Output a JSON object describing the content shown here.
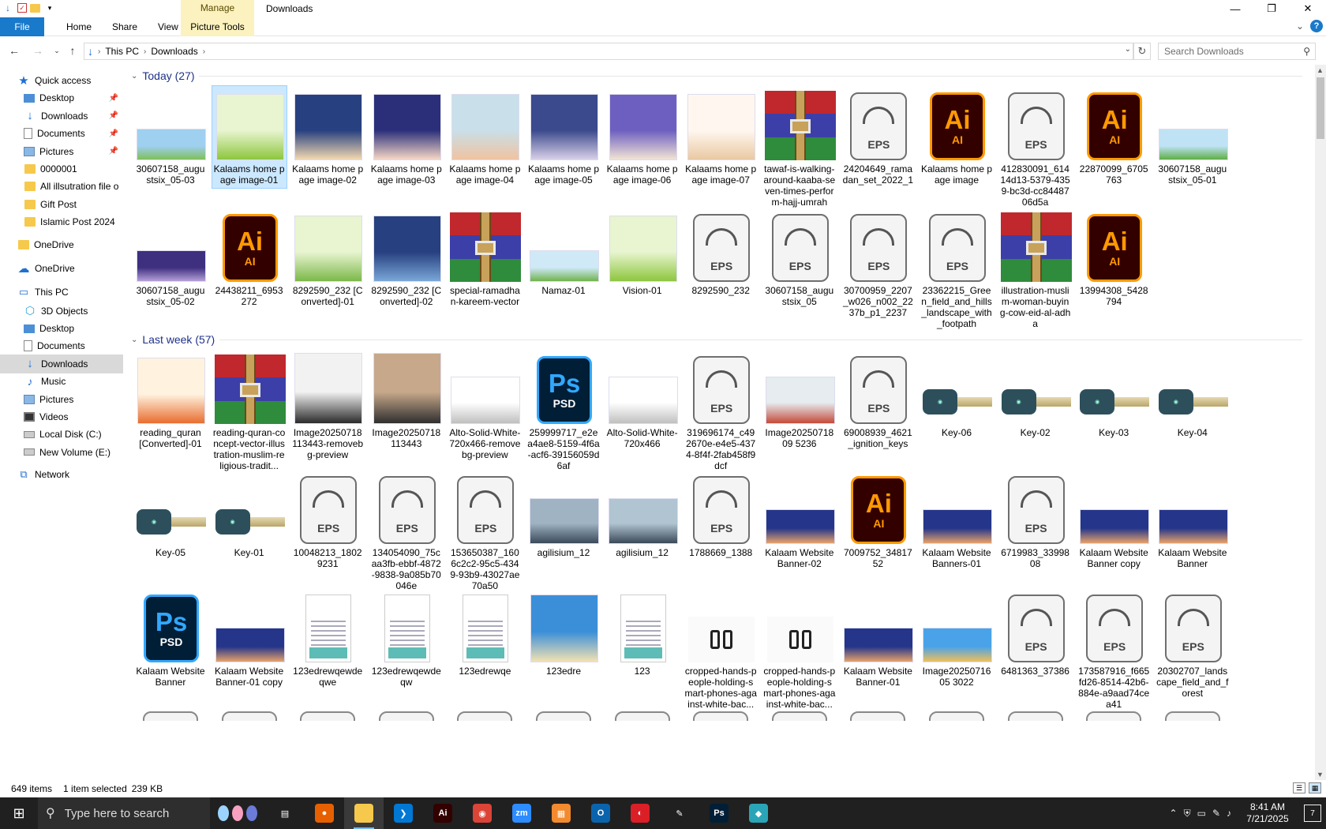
{
  "window": {
    "title": "Downloads",
    "manage_tab": "Manage",
    "picture_tools_tab": "Picture Tools",
    "ribbon_tabs": [
      "File",
      "Home",
      "Share",
      "View"
    ],
    "buttons": {
      "minimize": "—",
      "maximize": "❐",
      "close": "✕",
      "collapse": "⌄",
      "help": "?"
    }
  },
  "address": {
    "crumbs": [
      "This PC",
      "Downloads"
    ],
    "search_placeholder": "Search Downloads"
  },
  "nav": {
    "items": [
      {
        "label": "Quick access",
        "icon": "star-icon",
        "indent": 1,
        "kind": "star"
      },
      {
        "label": "Desktop",
        "icon": "desktop-icon",
        "indent": 2,
        "kind": "blue",
        "pin": true
      },
      {
        "label": "Downloads",
        "icon": "download-icon",
        "indent": 2,
        "kind": "dl",
        "pin": true
      },
      {
        "label": "Documents",
        "icon": "documents-icon",
        "indent": 2,
        "kind": "doc",
        "pin": true
      },
      {
        "label": "Pictures",
        "icon": "pictures-icon",
        "indent": 2,
        "kind": "pic",
        "pin": true
      },
      {
        "label": "0000001",
        "icon": "folder-icon",
        "indent": 2,
        "kind": "folder"
      },
      {
        "label": "All illsutration file o",
        "icon": "folder-icon",
        "indent": 2,
        "kind": "folder"
      },
      {
        "label": "Gift Post",
        "icon": "folder-icon",
        "indent": 2,
        "kind": "folder"
      },
      {
        "label": "Islamic Post 2024",
        "icon": "folder-icon",
        "indent": 2,
        "kind": "folder"
      },
      {
        "label": "OneDrive",
        "icon": "folder-icon",
        "indent": 1,
        "kind": "folder",
        "gap": 6
      },
      {
        "label": "OneDrive",
        "icon": "cloud-icon",
        "indent": 1,
        "kind": "cloud",
        "gap": 6
      },
      {
        "label": "This PC",
        "icon": "computer-icon",
        "indent": 1,
        "kind": "pc",
        "gap": 6
      },
      {
        "label": "3D Objects",
        "icon": "3d-objects-icon",
        "indent": 2,
        "kind": "3d"
      },
      {
        "label": "Desktop",
        "icon": "desktop-icon",
        "indent": 2,
        "kind": "blue"
      },
      {
        "label": "Documents",
        "icon": "documents-icon",
        "indent": 2,
        "kind": "doc"
      },
      {
        "label": "Downloads",
        "icon": "download-icon",
        "indent": 2,
        "kind": "dl",
        "selected": true
      },
      {
        "label": "Music",
        "icon": "music-icon",
        "indent": 2,
        "kind": "music"
      },
      {
        "label": "Pictures",
        "icon": "pictures-icon",
        "indent": 2,
        "kind": "pic"
      },
      {
        "label": "Videos",
        "icon": "videos-icon",
        "indent": 2,
        "kind": "vid"
      },
      {
        "label": "Local Disk (C:)",
        "icon": "disk-icon",
        "indent": 2,
        "kind": "disk"
      },
      {
        "label": "New Volume (E:)",
        "icon": "disk-icon",
        "indent": 2,
        "kind": "disk"
      },
      {
        "label": "Network",
        "icon": "network-icon",
        "indent": 1,
        "kind": "net",
        "gap": 6
      }
    ]
  },
  "groups": [
    {
      "header": "Today (27)",
      "rows": [
        [
          {
            "label": "30607158_augustsix_05-03",
            "type": "img",
            "colors": [
              "#9fd0f0",
              "#7fbf5a"
            ],
            "h": 40
          },
          {
            "label": "Kalaams home page image-01",
            "type": "img",
            "colors": [
              "#e8f5d0",
              "#8dc63f"
            ],
            "h": 84,
            "selected": true
          },
          {
            "label": "Kalaams home page image-02",
            "type": "img",
            "colors": [
              "#27407f",
              "#f3d9b1"
            ],
            "h": 84
          },
          {
            "label": "Kalaams home page image-03",
            "type": "img",
            "colors": [
              "#2b2f7a",
              "#f5d7c7"
            ],
            "h": 84
          },
          {
            "label": "Kalaams home page image-04",
            "type": "img",
            "colors": [
              "#c9dfe9",
              "#f0c3a0"
            ],
            "h": 84
          },
          {
            "label": "Kalaams home page image-05",
            "type": "img",
            "colors": [
              "#3b4a8c",
              "#d8d0e8"
            ],
            "h": 84
          },
          {
            "label": "Kalaams home page image-06",
            "type": "img",
            "colors": [
              "#6d5fc0",
              "#f2e4d5"
            ],
            "h": 84
          },
          {
            "label": "Kalaams home page image-07",
            "type": "img",
            "colors": [
              "#fff7ef",
              "#e9c9a2"
            ],
            "h": 84
          },
          {
            "label": "tawaf-is-walking-around-kaaba-seven-times-perform-hajj-umrah",
            "type": "rar"
          },
          {
            "label": "24204649_ramadan_set_2022_1",
            "type": "eps"
          },
          {
            "label": "Kalaams home page image",
            "type": "ai"
          },
          {
            "label": "412830091_61414d13-5379-4359-bc3d-cc8448706d5a",
            "type": "eps"
          },
          {
            "label": "22870099_6705763",
            "type": "ai"
          },
          {
            "label": "30607158_augustsix_05-01",
            "type": "img",
            "colors": [
              "#bfe3f5",
              "#5fae46"
            ],
            "h": 40
          }
        ],
        [
          {
            "label": "30607158_augustsix_05-02",
            "type": "img",
            "colors": [
              "#3e2f7f",
              "#b6a0d8"
            ],
            "h": 40
          },
          {
            "label": "24438211_6953272",
            "type": "ai"
          },
          {
            "label": "8292590_232 [Converted]-01",
            "type": "img",
            "colors": [
              "#e8f5d0",
              "#7cb84a"
            ],
            "h": 84
          },
          {
            "label": "8292590_232 [Converted]-02",
            "type": "img",
            "colors": [
              "#27407f",
              "#7aa7d9"
            ],
            "h": 84
          },
          {
            "label": "special-ramadhan-kareem-vector",
            "type": "rar"
          },
          {
            "label": "Namaz-01",
            "type": "img",
            "colors": [
              "#cfe9f7",
              "#6fb34c"
            ],
            "h": 40
          },
          {
            "label": "Vision-01",
            "type": "img",
            "colors": [
              "#e8f5d0",
              "#8dc63f"
            ],
            "h": 84
          },
          {
            "label": "8292590_232",
            "type": "eps"
          },
          {
            "label": "30607158_augustsix_05",
            "type": "eps"
          },
          {
            "label": "30700959_2207_w026_n002_2237b_p1_2237",
            "type": "eps"
          },
          {
            "label": "23362215_Green_field_and_hills_landscape_with_footpath",
            "type": "eps"
          },
          {
            "label": "illustration-muslim-woman-buying-cow-eid-al-adha",
            "type": "rar"
          },
          {
            "label": "13994308_5428794",
            "type": "ai"
          }
        ]
      ]
    },
    {
      "header": "Last week (57)",
      "rows": [
        [
          {
            "label": "reading_quran [Converted]-01",
            "type": "img",
            "colors": [
              "#fff3e0",
              "#e86d2f"
            ],
            "h": 84
          },
          {
            "label": "reading-quran-concept-vector-illustration-muslim-religious-tradit...",
            "type": "rar"
          },
          {
            "label": "Image20250718113443-removebg-preview",
            "type": "img",
            "colors": [
              "#f2f2f2",
              "#2b2b2b"
            ],
            "h": 90
          },
          {
            "label": "Image20250718113443",
            "type": "img",
            "colors": [
              "#c7a88a",
              "#2f2f2f"
            ],
            "h": 90
          },
          {
            "label": "Alto-Solid-White-720x466-removebg-preview",
            "type": "img",
            "colors": [
              "#ffffff",
              "#bfbfbf"
            ],
            "h": 60
          },
          {
            "label": "259999717_e2ea4ae8-5159-4f6a-acf6-39156059d6af",
            "type": "ps"
          },
          {
            "label": "Alto-Solid-White-720x466",
            "type": "img",
            "colors": [
              "#ffffff",
              "#c0c0c0"
            ],
            "h": 60
          },
          {
            "label": "319696174_c492670e-e4e5-4374-8f4f-2fab458f9dcf",
            "type": "eps"
          },
          {
            "label": "Image2025071809 5236",
            "type": "img",
            "colors": [
              "#e6ecef",
              "#c44a3a"
            ],
            "h": 60
          },
          {
            "label": "69008939_4621_ignition_keys",
            "type": "eps"
          },
          {
            "label": "Key-06",
            "type": "key"
          },
          {
            "label": "Key-02",
            "type": "key"
          },
          {
            "label": "Key-03",
            "type": "key"
          },
          {
            "label": "Key-04",
            "type": "key"
          }
        ],
        [
          {
            "label": "Key-05",
            "type": "key"
          },
          {
            "label": "Key-01",
            "type": "key"
          },
          {
            "label": "10048213_18029231",
            "type": "eps"
          },
          {
            "label": "134054090_75caa3fb-ebbf-4872-9838-9a085b70046e",
            "type": "eps"
          },
          {
            "label": "153650387_1606c2c2-95c5-4349-93b9-43027ae70a50",
            "type": "eps"
          },
          {
            "label": "agilisium_12",
            "type": "img",
            "colors": [
              "#9fb3c2",
              "#3a4a5a"
            ],
            "h": 58
          },
          {
            "label": "agilisium_12",
            "type": "img",
            "colors": [
              "#b0c4d2",
              "#3c4a58"
            ],
            "h": 58
          },
          {
            "label": "1788669_1388",
            "type": "eps"
          },
          {
            "label": "Kalaam Website Banner-02",
            "type": "img",
            "colors": [
              "#25358a",
              "#e8a36a"
            ],
            "h": 44
          },
          {
            "label": "7009752_3481752",
            "type": "ai"
          },
          {
            "label": "Kalaam Website Banners-01",
            "type": "img",
            "colors": [
              "#25358a",
              "#e8a36a"
            ],
            "h": 44
          },
          {
            "label": "6719983_3399808",
            "type": "eps"
          },
          {
            "label": "Kalaam Website Banner copy",
            "type": "img",
            "colors": [
              "#25358a",
              "#e8a36a"
            ],
            "h": 44
          },
          {
            "label": "Kalaam Website Banner",
            "type": "img",
            "colors": [
              "#25358a",
              "#e8a36a"
            ],
            "h": 44
          }
        ],
        [
          {
            "label": "Kalaam Website Banner",
            "type": "ps"
          },
          {
            "label": "Kalaam Website Banner-01 copy",
            "type": "img",
            "colors": [
              "#25358a",
              "#e8a36a"
            ],
            "h": 44
          },
          {
            "label": "123edrewqewdeqwe",
            "type": "doc"
          },
          {
            "label": "123edrewqewdeqw",
            "type": "doc"
          },
          {
            "label": "123edrewqe",
            "type": "doc"
          },
          {
            "label": "123edre",
            "type": "img",
            "colors": [
              "#3b8fd8",
              "#f3e2b3"
            ],
            "h": 86
          },
          {
            "label": "123",
            "type": "doc"
          },
          {
            "label": "cropped-hands-people-holding-smart-phones-against-white-bac...",
            "type": "phone"
          },
          {
            "label": "cropped-hands-people-holding-smart-phones-against-white-bac...",
            "type": "phone"
          },
          {
            "label": "Kalaam Website Banner-01",
            "type": "img",
            "colors": [
              "#25358a",
              "#e8a36a"
            ],
            "h": 44
          },
          {
            "label": "Image2025071605 3022",
            "type": "img",
            "colors": [
              "#4aa3e8",
              "#f0c05a"
            ],
            "h": 44
          },
          {
            "label": "6481363_37386",
            "type": "eps"
          },
          {
            "label": "173587916_f665fd26-8514-42b6-884e-a9aad74cea41",
            "type": "eps"
          },
          {
            "label": "20302707_landscape_field_and_forest",
            "type": "eps"
          }
        ]
      ]
    }
  ],
  "status": {
    "items": "649 items",
    "selected": "1 item selected",
    "size": "239 KB"
  },
  "taskbar": {
    "search_placeholder": "Type here to search",
    "apps": [
      {
        "name": "task-view-icon",
        "text": "▤",
        "color": "#202020"
      },
      {
        "name": "firefox-icon",
        "text": "●",
        "color": "#e66000"
      },
      {
        "name": "file-explorer-icon",
        "text": "",
        "color": "#f6c94c",
        "active": true
      },
      {
        "name": "vscode-icon",
        "text": "❯",
        "color": "#0078d4"
      },
      {
        "name": "illustrator-icon",
        "text": "Ai",
        "color": "#330000"
      },
      {
        "name": "chrome-icon",
        "text": "◉",
        "color": "#db4437"
      },
      {
        "name": "zoom-icon",
        "text": "zm",
        "color": "#2d8cff"
      },
      {
        "name": "rar-icon",
        "text": "▦",
        "color": "#f28a2e"
      },
      {
        "name": "outlook-icon",
        "text": "O",
        "color": "#0a64ad"
      },
      {
        "name": "creative-cloud-icon",
        "text": "◐",
        "color": "#da1f26"
      },
      {
        "name": "pen-tool-icon",
        "text": "✎",
        "color": "#202020"
      },
      {
        "name": "photoshop-icon",
        "text": "Ps",
        "color": "#001e36"
      },
      {
        "name": "app-diamond-icon",
        "text": "◆",
        "color": "#2aa5b8"
      }
    ],
    "time": "8:41 AM",
    "date": "7/21/2025",
    "notifications": "7"
  }
}
